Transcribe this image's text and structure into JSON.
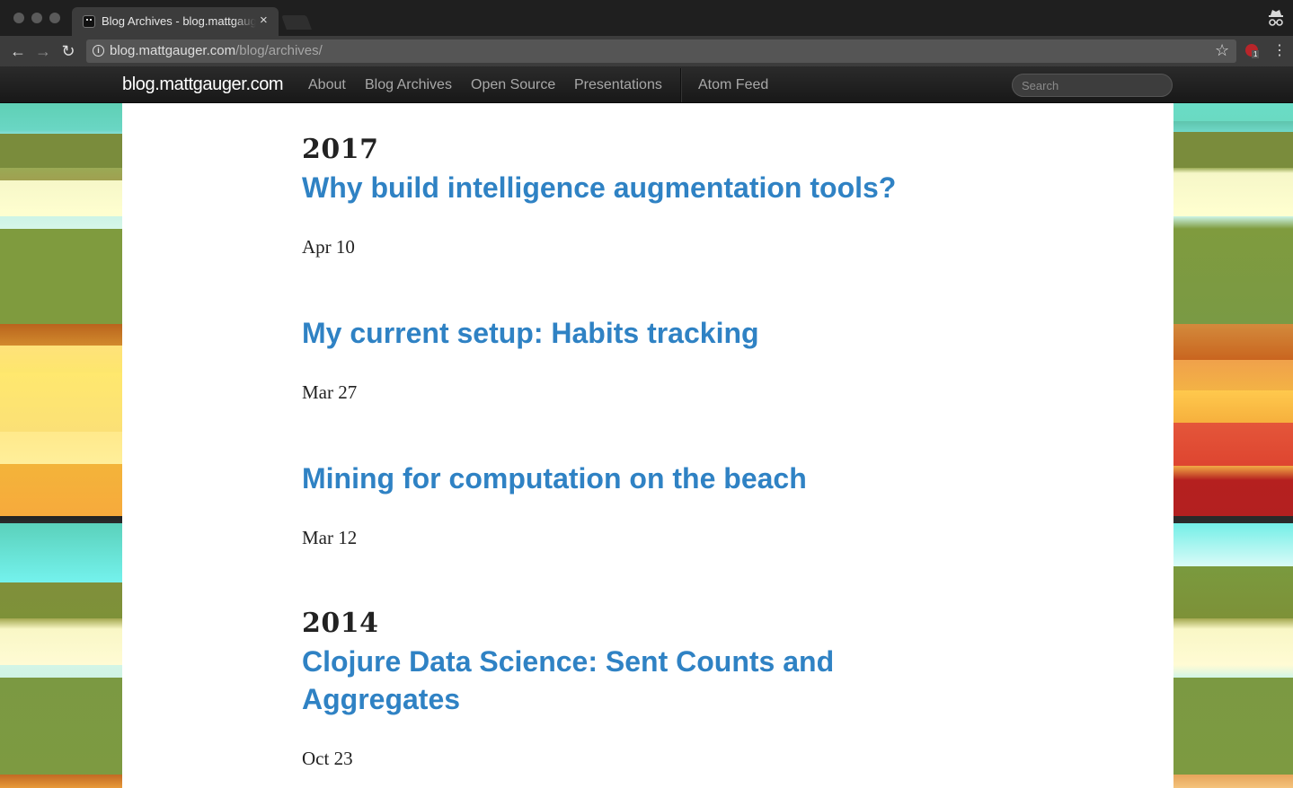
{
  "browser": {
    "tab_title": "Blog Archives - blog.mattgauger.com",
    "tab_close": "×",
    "url_host": "blog.mattgauger.com",
    "url_path": "/blog/archives/",
    "back_glyph": "←",
    "forward_glyph": "→",
    "reload_glyph": "↻",
    "star_glyph": "☆",
    "menu_glyph": "⋮",
    "info_glyph": "i",
    "extension_badge": "1"
  },
  "site": {
    "brand": "blog.mattgauger.com",
    "nav": [
      "About",
      "Blog Archives",
      "Open Source",
      "Presentations"
    ],
    "feed": "Atom Feed",
    "search_placeholder": "Search",
    "link_color": "#2f82c4"
  },
  "archives": [
    {
      "year": "2017",
      "posts": [
        {
          "title": "Why build intelligence augmentation tools?",
          "date": "Apr 10"
        },
        {
          "title": "My current setup: Habits tracking",
          "date": "Mar 27"
        },
        {
          "title": "Mining for computation on the beach",
          "date": "Mar 12"
        }
      ]
    },
    {
      "year": "2014",
      "posts": [
        {
          "title": "Clojure Data Science: Sent Counts and Aggregates",
          "date": "Oct 23"
        }
      ]
    }
  ]
}
